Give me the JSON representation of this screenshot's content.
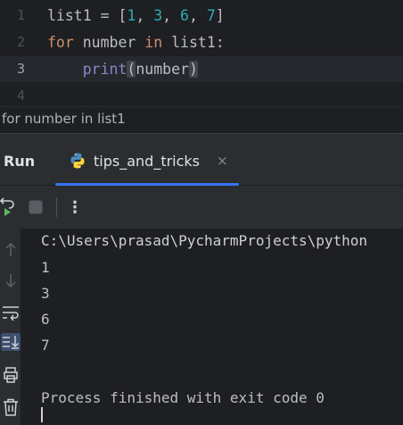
{
  "editor": {
    "lines": [
      {
        "number": "1",
        "tokens": [
          {
            "text": "list1 = ",
            "cls": ""
          },
          {
            "text": "[",
            "cls": ""
          },
          {
            "text": "1",
            "cls": "num"
          },
          {
            "text": ", ",
            "cls": ""
          },
          {
            "text": "3",
            "cls": "num"
          },
          {
            "text": ", ",
            "cls": ""
          },
          {
            "text": "6",
            "cls": "num"
          },
          {
            "text": ", ",
            "cls": ""
          },
          {
            "text": "7",
            "cls": "num"
          },
          {
            "text": "]",
            "cls": ""
          }
        ]
      },
      {
        "number": "2",
        "tokens": [
          {
            "text": "for",
            "cls": "kw"
          },
          {
            "text": " number ",
            "cls": ""
          },
          {
            "text": "in",
            "cls": "kw"
          },
          {
            "text": " list1:",
            "cls": ""
          }
        ]
      },
      {
        "number": "3",
        "tokens": [
          {
            "text": "    ",
            "cls": ""
          },
          {
            "text": "print",
            "cls": "bi"
          },
          {
            "text": "(",
            "cls": "br-hl"
          },
          {
            "text": "number",
            "cls": ""
          },
          {
            "text": ")",
            "cls": "br-hl"
          }
        ]
      },
      {
        "number": "4",
        "tokens": []
      }
    ],
    "current_line": 3
  },
  "breadcrumb": {
    "text": "for number in list1"
  },
  "run_window": {
    "title": "Run",
    "tab": {
      "label": "tips_and_tricks",
      "close_glyph": "×",
      "icon": "python-icon"
    },
    "toolbar": {
      "rerun_icon": "rerun-icon",
      "stop_icon": "stop-icon",
      "more_glyph": "⋮"
    },
    "side_icons": [
      "arrow-up-icon",
      "arrow-down-icon",
      "soft-wrap-icon",
      "scroll-to-end-icon",
      "print-icon",
      "trash-icon"
    ],
    "console": {
      "command": "C:\\Users\\prasad\\PycharmProjects\\python",
      "output": [
        "1",
        "3",
        "6",
        "7"
      ],
      "finish_message": "Process finished with exit code 0"
    }
  },
  "colors": {
    "background": "#1e1f22",
    "panel": "#2b2d30",
    "keyword": "#cf8e6d",
    "number": "#2aacb8",
    "builtin": "#8888c6",
    "accent": "#3574f0",
    "run_green": "#5fb865"
  }
}
